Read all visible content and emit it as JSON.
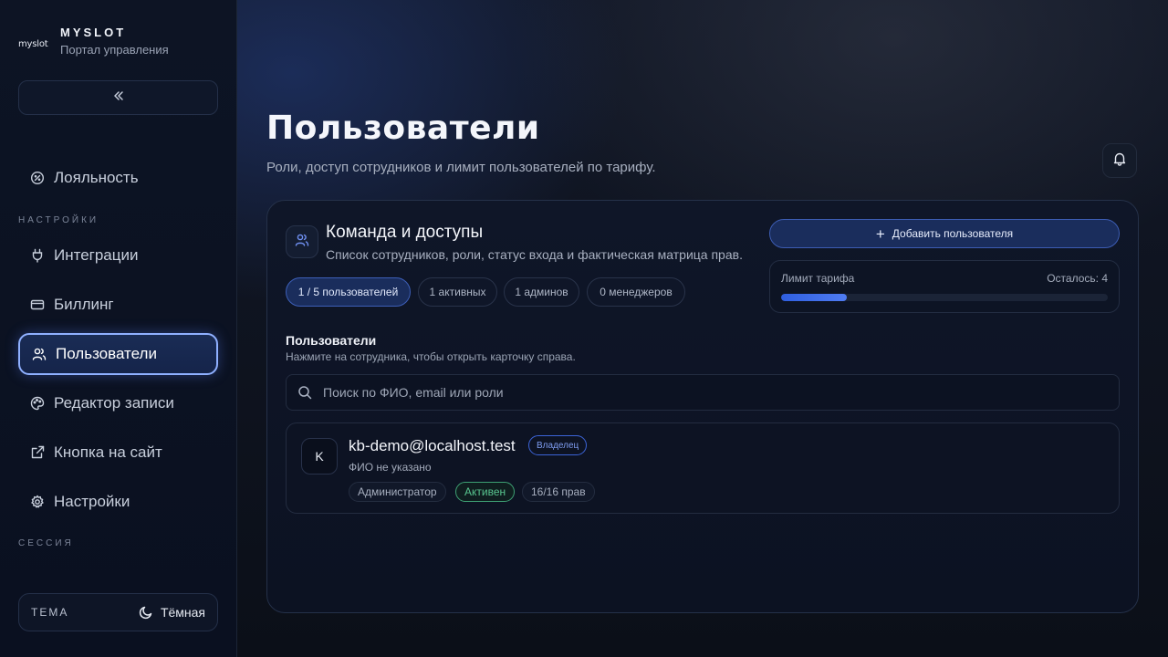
{
  "brand": {
    "logo": "myslot",
    "name": "MYSLOT",
    "subtitle": "Портал управления"
  },
  "sidebar": {
    "collapse_icon": "double-chevron-left",
    "items": [
      {
        "label": "Лояльность",
        "icon": "loyalty-icon",
        "active": false
      },
      {
        "label": "Интеграции",
        "icon": "plug-icon",
        "active": false
      },
      {
        "label": "Биллинг",
        "icon": "credit-card-icon",
        "active": false
      },
      {
        "label": "Пользователи",
        "icon": "users-icon",
        "active": true
      },
      {
        "label": "Редактор записи",
        "icon": "palette-icon",
        "active": false
      },
      {
        "label": "Кнопка на сайт",
        "icon": "external-link-icon",
        "active": false
      },
      {
        "label": "Настройки",
        "icon": "gear-icon",
        "active": false
      }
    ],
    "sections": {
      "settings": "НАСТРОЙКИ",
      "session": "СЕССИЯ"
    },
    "theme": {
      "label": "ТЕМА",
      "value": "Тёмная",
      "icon": "moon-icon"
    }
  },
  "header": {
    "title": "Пользователи",
    "subtitle": "Роли, доступ сотрудников и лимит пользователей по тарифу.",
    "bell_icon": "bell-icon"
  },
  "team": {
    "title": "Команда и доступы",
    "description": "Список сотрудников, роли, статус входа и фактическая матрица прав.",
    "chips": [
      "1 / 5 пользователей",
      "1 активных",
      "1 админов",
      "0 менеджеров"
    ],
    "add_button": "Добавить пользователя",
    "limit": {
      "label": "Лимит тарифа",
      "remaining": "Осталось: 4",
      "used": 1,
      "total": 5,
      "fraction": 0.2
    }
  },
  "users": {
    "title": "Пользователи",
    "hint": "Нажмите на сотрудника, чтобы открыть карточку справа.",
    "search_placeholder": "Поиск по ФИО, email или роли",
    "list": [
      {
        "avatar": "K",
        "email": "kb-demo@localhost.test",
        "badge": "Владелец",
        "fio": "ФИО не указано",
        "role": "Администратор",
        "status": "Активен",
        "rights": "16/16 прав"
      }
    ]
  },
  "colors": {
    "accent": "#3d5fb8",
    "active_border": "#8fb0ff",
    "status_active": "#58c58f",
    "badge": "#7e9cf0",
    "bar_fill": "#2f5fe0"
  }
}
